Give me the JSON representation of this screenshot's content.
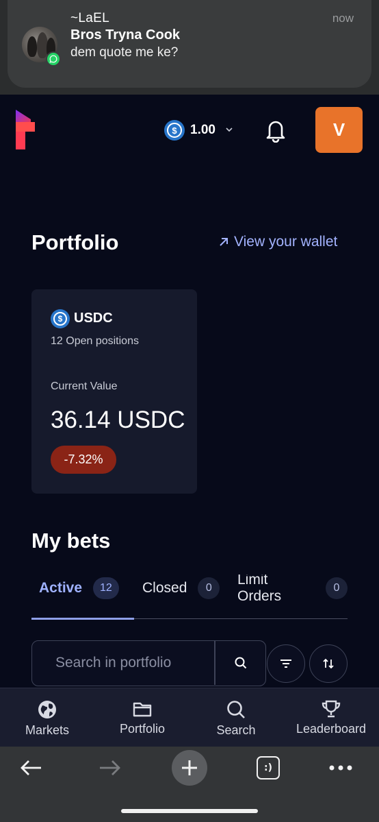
{
  "notification": {
    "sender": "~LaEL",
    "title": "Bros Tryna Cook",
    "message": "dem quote me ke?",
    "time": "now",
    "app_icon": "whatsapp-icon"
  },
  "header": {
    "logo": "app-logo",
    "balance": "1.00",
    "balance_currency_icon": "usdc-coin-icon",
    "avatar_initial": "V",
    "avatar_color": "#e8732a"
  },
  "portfolio": {
    "title": "Portfolio",
    "view_wallet": "View your wallet",
    "card": {
      "currency": "USDC",
      "positions": "12 Open positions",
      "value_label": "Current Value",
      "value": "36.14 USDC",
      "change": "-7.32%",
      "change_color": "#8a2416"
    }
  },
  "bets": {
    "title": "My bets",
    "tabs": [
      {
        "label": "Active",
        "count": "12",
        "active": true
      },
      {
        "label": "Closed",
        "count": "0",
        "active": false
      },
      {
        "label": "Limit Orders",
        "count": "0",
        "active": false
      }
    ],
    "search_placeholder": "Search in portfolio"
  },
  "bottom_nav": {
    "items": [
      {
        "label": "Markets",
        "icon": "globe-icon"
      },
      {
        "label": "Portfolio",
        "icon": "folder-icon"
      },
      {
        "label": "Search",
        "icon": "search-icon"
      },
      {
        "label": "Leaderboard",
        "icon": "trophy-icon"
      }
    ]
  },
  "browser": {
    "tabs_label": ":)"
  },
  "colors": {
    "background": "#070a1a",
    "accent": "#9fb2ff",
    "card": "#161a2c"
  }
}
